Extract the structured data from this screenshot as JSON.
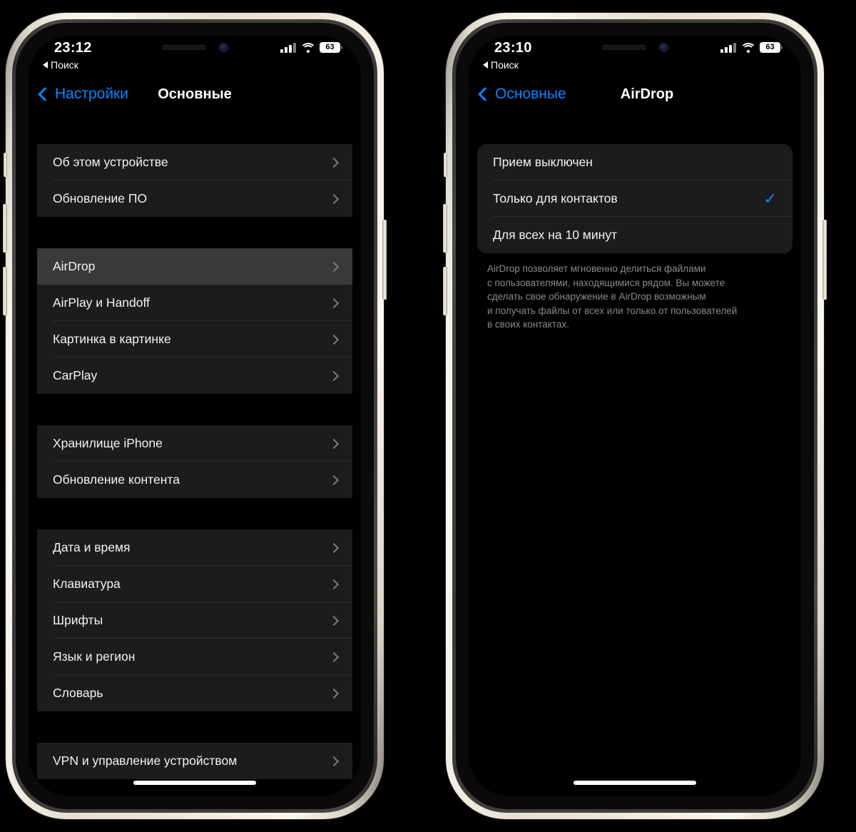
{
  "phones": [
    {
      "id": "settings-general",
      "status_bar": {
        "time": "23:12",
        "back_label": "Поиск",
        "battery_percent": "63"
      },
      "nav": {
        "back_label": "Настройки",
        "title": "Основные"
      },
      "groups": [
        {
          "rows": [
            {
              "label": "Об этом устройстве",
              "accessory": "chevron"
            },
            {
              "label": "Обновление ПО",
              "accessory": "chevron"
            }
          ]
        },
        {
          "rows": [
            {
              "label": "AirDrop",
              "accessory": "chevron",
              "selected": true
            },
            {
              "label": "AirPlay и Handoff",
              "accessory": "chevron"
            },
            {
              "label": "Картинка в картинке",
              "accessory": "chevron"
            },
            {
              "label": "CarPlay",
              "accessory": "chevron"
            }
          ]
        },
        {
          "rows": [
            {
              "label": "Хранилище iPhone",
              "accessory": "chevron"
            },
            {
              "label": "Обновление контента",
              "accessory": "chevron"
            }
          ]
        },
        {
          "rows": [
            {
              "label": "Дата и время",
              "accessory": "chevron"
            },
            {
              "label": "Клавиатура",
              "accessory": "chevron"
            },
            {
              "label": "Шрифты",
              "accessory": "chevron"
            },
            {
              "label": "Язык и регион",
              "accessory": "chevron"
            },
            {
              "label": "Словарь",
              "accessory": "chevron"
            }
          ]
        },
        {
          "rows": [
            {
              "label": "VPN и управление устройством",
              "accessory": "chevron"
            }
          ]
        }
      ],
      "footnote": ""
    },
    {
      "id": "airdrop",
      "status_bar": {
        "time": "23:10",
        "back_label": "Поиск",
        "battery_percent": "63"
      },
      "nav": {
        "back_label": "Основные",
        "title": "AirDrop"
      },
      "groups": [
        {
          "rounded": true,
          "rows": [
            {
              "label": "Прием выключен",
              "accessory": "none"
            },
            {
              "label": "Только для контактов",
              "accessory": "check",
              "selected": false
            },
            {
              "label": "Для всех на 10 минут",
              "accessory": "none"
            }
          ]
        }
      ],
      "footnote": "AirDrop позволяет мгновенно делиться файлами\nс пользователями, находящимися рядом. Вы можете\nсделать свое обнаружение в AirDrop возможным\nи получать файлы от всех или только от пользователей\nв своих контактах."
    }
  ],
  "colors": {
    "accent": "#0a84ff",
    "card": "#1c1c1e",
    "card_selected": "#3a3a3c",
    "separator": "#2e2e30",
    "text": "#f2f2f2",
    "footnote": "#8a8a8e",
    "background": "#000000"
  },
  "icons": {
    "chevron_right": "chevron-right-icon",
    "chevron_left": "chevron-left-icon",
    "check": "✓",
    "back_triangle": "triangle-left-icon",
    "signal": "cellular-signal-icon",
    "wifi": "wifi-icon",
    "battery": "battery-icon"
  }
}
